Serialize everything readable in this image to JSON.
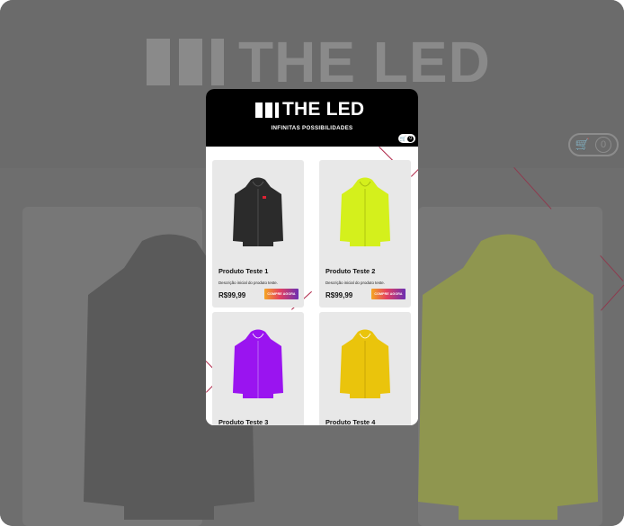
{
  "brand": {
    "name": "THE LED",
    "tagline": "INFINITAS POSSIBILIDADES"
  },
  "cart": {
    "icon": "cart-icon",
    "count": "0"
  },
  "products": [
    {
      "name": "Produto Teste 1",
      "description": "Descrição inicial do produto teste.",
      "price": "R$99,99",
      "buy_label": "COMPRE AGORA",
      "hoodie_color": "#2b2b2b"
    },
    {
      "name": "Produto Teste 2",
      "description": "Descrição inicial do produto teste.",
      "price": "R$99,99",
      "buy_label": "COMPRE AGORA",
      "hoodie_color": "#d4f01c"
    },
    {
      "name": "Produto Teste 3",
      "hoodie_color": "#9a14f0"
    },
    {
      "name": "Produto Teste 4",
      "hoodie_color": "#eac40c"
    }
  ],
  "colors": {
    "overlay": "#6e6e6e",
    "header": "#000000",
    "card": "#e8e8e8",
    "accent_line": "#b0284a",
    "button_gradient": [
      "#f5a623",
      "#e4405f",
      "#6b2fb3"
    ]
  }
}
